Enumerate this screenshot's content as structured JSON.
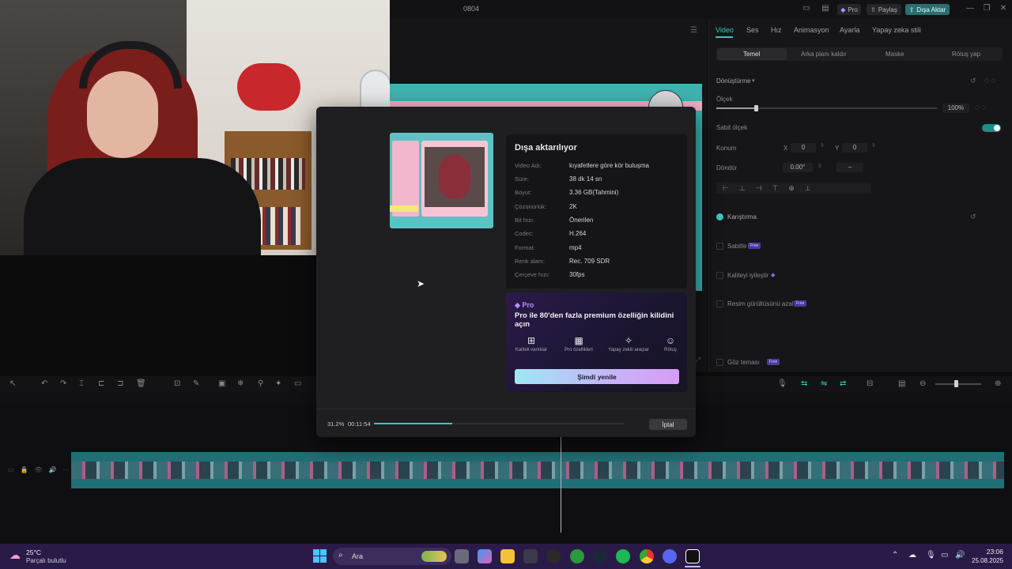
{
  "titlebar": {
    "title": "0804",
    "pro_label": "Pro",
    "share_label": "Paylaş",
    "export_label": "Dışa Aktar",
    "minimize": "—",
    "maximize": "❐",
    "close": "✕"
  },
  "right_panel": {
    "tabs": [
      "Video",
      "Ses",
      "Hız",
      "Animasyon",
      "Ayarla",
      "Yapay zeka stili"
    ],
    "subtabs": [
      "Temel",
      "Arka planı kaldır",
      "Maske",
      "Rötuş yap"
    ],
    "transform_label": "Dönüştürme",
    "scale_label": "Ölçek",
    "scale_value": "100%",
    "scale_fraction": 0.18,
    "fixed_scale_label": "Sabit ölçek",
    "position_label": "Konum",
    "pos_x_label": "X",
    "pos_x_value": "0",
    "pos_y_label": "Y",
    "pos_y_value": "0",
    "rotate_label": "Döndür",
    "rotate_value": "0.00°",
    "rotate_dash": "–",
    "blend_label": "Karıştırma",
    "stabilize_label": "Sabitle",
    "stabilize_badge": "Free",
    "enhance_label": "Kaliteyi iyileştir",
    "denoise_label": "Resim gürültüsünü azalt",
    "denoise_badge": "Free",
    "eye_contact_label": "Göz teması",
    "eye_contact_badge": "Free"
  },
  "export_dialog": {
    "title": "Dışa aktarılıyor",
    "rows": [
      {
        "label": "Video Adı:",
        "value": "kıyafetlere göre kör buluşma"
      },
      {
        "label": "Süre:",
        "value": "38 dk 14 sn"
      },
      {
        "label": "Boyut:",
        "value": "3.36 GB(Tahmini)"
      },
      {
        "label": "Çözünürlük:",
        "value": "2K"
      },
      {
        "label": "Bit hızı:",
        "value": "Önerilen"
      },
      {
        "label": "Codec:",
        "value": "H.264"
      },
      {
        "label": "Format:",
        "value": "mp4"
      },
      {
        "label": "Renk alanı:",
        "value": "Rec. 709 SDR"
      },
      {
        "label": "Çerçeve hızı:",
        "value": "30fps"
      }
    ],
    "pro_tag": "Pro",
    "pro_title": "Pro ile 80'den fazla premium özelliğin kilidini açın",
    "features": [
      {
        "icon": "image-enhance-icon",
        "label": "Kaliteli varlıklar"
      },
      {
        "icon": "grid-icon",
        "label": "Pro özellikleri"
      },
      {
        "icon": "magic-wand-icon",
        "label": "Yapay zekili araçlar"
      },
      {
        "icon": "retouch-icon",
        "label": "Rötuş"
      }
    ],
    "upgrade_label": "Şimdi yenile",
    "progress_percent": "31.2%",
    "progress_fraction": 0.312,
    "progress_time": "00:11:54",
    "cancel_label": "İptal"
  },
  "taskbar": {
    "weather_temp": "25°C",
    "weather_desc": "Parçalı bulutlu",
    "search_placeholder": "Ara",
    "clock_time": "23:06",
    "clock_date": "25.08.2025"
  },
  "colors": {
    "accent": "#3cc5c0",
    "pro_purple": "#b78cff"
  }
}
